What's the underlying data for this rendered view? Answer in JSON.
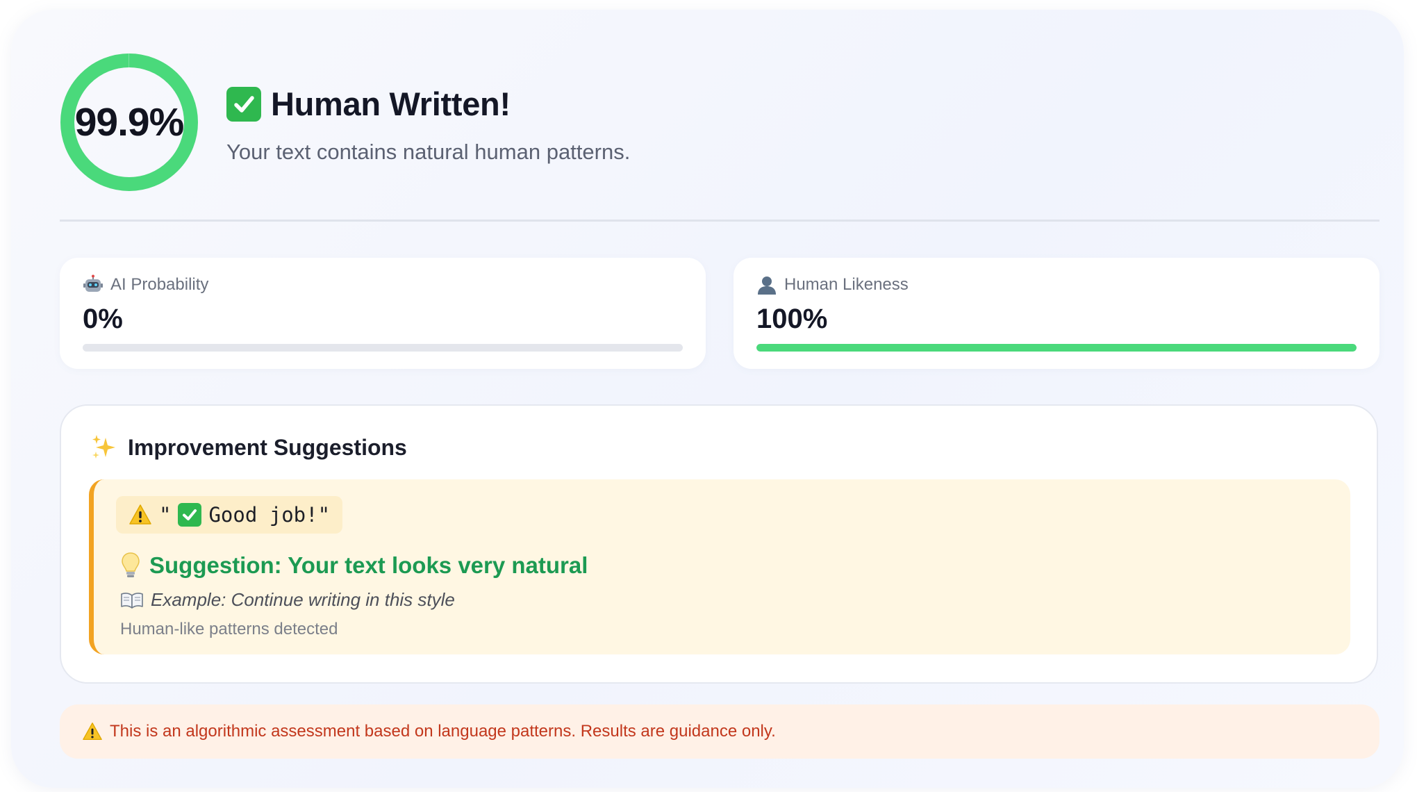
{
  "score": {
    "value_text": "99.9%",
    "fraction": 0.999,
    "ring_color": "#4ad97b"
  },
  "verdict": {
    "icon": "check-mark-icon",
    "heading": "Human Written!",
    "subtitle": "Your text contains natural human patterns."
  },
  "metrics": [
    {
      "icon": "robot-icon",
      "label": "AI Probability",
      "value": "0%",
      "fraction": 0.0,
      "color": "#b9bdc7"
    },
    {
      "icon": "user-silhouette-icon",
      "label": "Human Likeness",
      "value": "100%",
      "fraction": 1.0,
      "color": "#4ad97b"
    }
  ],
  "suggestions": {
    "icon": "sparkles-icon",
    "title": "Improvement Suggestions",
    "items": [
      {
        "warning_icon": "warning-icon",
        "quote_open": "\"",
        "quote_text": " Good job!\"",
        "suggestion_icon": "light-bulb-icon",
        "suggestion": "Suggestion: Your text looks very natural",
        "example_icon": "open-book-icon",
        "example": "Example: Continue writing in this style",
        "note": "Human-like patterns detected"
      }
    ]
  },
  "disclaimer": {
    "icon": "warning-icon",
    "text": "This is an algorithmic assessment based on language patterns. Results are guidance only."
  },
  "colors": {
    "accent_green": "#4ad97b",
    "suggestion_green": "#1c9a52",
    "warning_orange": "#f2a322",
    "disclaimer_red": "#c2371c"
  }
}
